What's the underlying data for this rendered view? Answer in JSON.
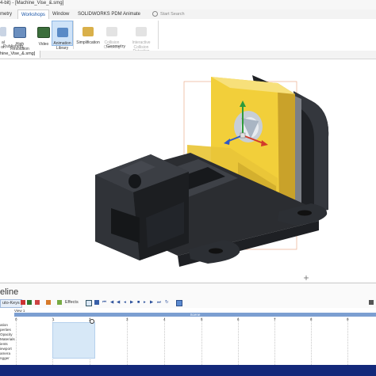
{
  "window": {
    "title": "4-bit) - [Machine_Vise_&.smg]"
  },
  "tabs": [
    {
      "label": "metry",
      "active": false
    },
    {
      "label": "Workshops",
      "active": true
    },
    {
      "label": "Window",
      "active": false
    },
    {
      "label": "SOLIDWORKS PDM",
      "active": false
    },
    {
      "label": "Animate",
      "active": false
    }
  ],
  "search": {
    "placeholder": "Start Search"
  },
  "ribbon": {
    "publishing": {
      "label": "Publishing",
      "buttons": [
        {
          "label": "al\non",
          "enabled": true
        },
        {
          "label": "High Resolution\nImage",
          "enabled": true
        },
        {
          "label": "Video",
          "enabled": true
        },
        {
          "label": "Animation\nLibrary",
          "enabled": true,
          "selected": true
        }
      ]
    },
    "geometry": {
      "label": "Geometry",
      "buttons": [
        {
          "label": "Simplification",
          "enabled": true
        },
        {
          "label": "Collision\nChecking",
          "enabled": false
        },
        {
          "label": "Interactive\nCollision Detection",
          "enabled": false
        }
      ]
    }
  },
  "document_tab": {
    "label": "hine_Vise_&.smg]"
  },
  "timeline": {
    "title": "eline",
    "toolbar": {
      "autokeys": "uto-Keys",
      "effects": "Effects"
    },
    "view_label": "View 1",
    "scene_label": "Scene",
    "ticks": [
      "0",
      "1",
      "2",
      "3",
      "4",
      "5",
      "6",
      "7",
      "8",
      "9"
    ],
    "rows": [
      "ation",
      "perties",
      "Opacity",
      "Materials",
      "ients",
      "iewport",
      "amera",
      "ngger"
    ]
  },
  "colors": {
    "accent": "#1a56a8",
    "yellow_part": "#f2cf3a",
    "body": "#2b2d31",
    "timeline_bar": "#7c9fd1",
    "status_bar": "#13287a"
  }
}
